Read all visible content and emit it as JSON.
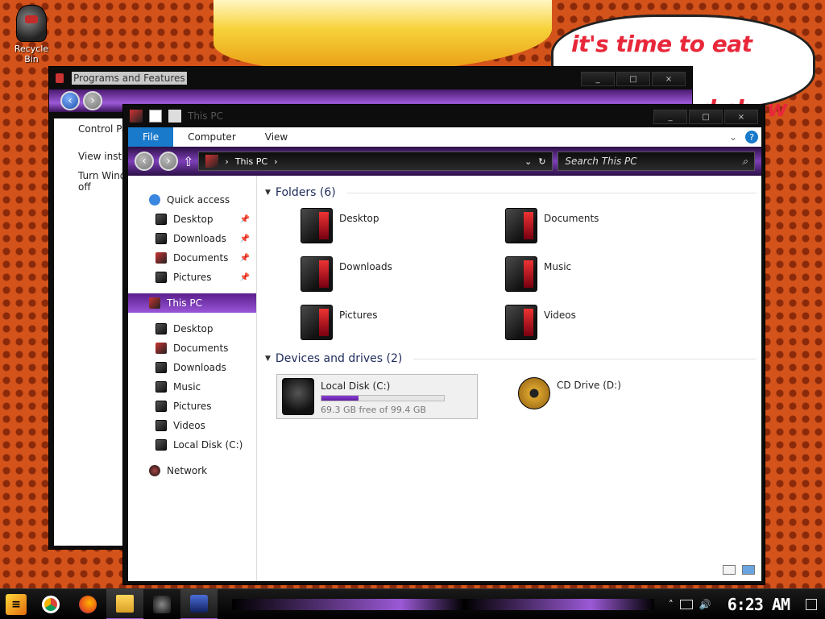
{
  "wallpaper": {
    "speech_line1": "it's time to eat shit",
    "speech_line2": "d chew",
    "speech_line3": "nd"
  },
  "desktop": {
    "icons": [
      {
        "label": "Recycle Bin",
        "icon": "recycle-bin-icon"
      }
    ]
  },
  "back_window": {
    "title": "Programs and Features",
    "controls": [
      "_",
      "□",
      "×"
    ],
    "sidebar": [
      "Control Pa",
      "View insta",
      "Turn Wind",
      "off"
    ]
  },
  "front_window": {
    "title": "This PC",
    "controls": [
      "_",
      "□",
      "×"
    ],
    "ribbon": {
      "tabs": [
        "File",
        "Computer",
        "View"
      ],
      "help": "?"
    },
    "address": {
      "path": "This PC",
      "separator": "›"
    },
    "search": {
      "placeholder": "Search This PC"
    },
    "nav": {
      "quick_access": "Quick access",
      "quick_items": [
        "Desktop",
        "Downloads",
        "Documents",
        "Pictures"
      ],
      "this_pc": "This PC",
      "pc_items": [
        "Desktop",
        "Documents",
        "Downloads",
        "Music",
        "Pictures",
        "Videos",
        "Local Disk (C:)"
      ],
      "network": "Network"
    },
    "folders": {
      "header": "Folders (6)",
      "items": [
        "Desktop",
        "Documents",
        "Downloads",
        "Music",
        "Pictures",
        "Videos"
      ]
    },
    "drives": {
      "header": "Devices and drives (2)",
      "items": [
        {
          "name": "Local Disk (C:)",
          "free": "69.3 GB free of 99.4 GB",
          "used_fraction": 0.3
        },
        {
          "name": "CD Drive (D:)"
        }
      ]
    }
  },
  "taskbar": {
    "clock": "6:23 AM",
    "apps": [
      "chrome-icon",
      "firefox-icon",
      "file-explorer-icon",
      "app-icon",
      "programs-and-features-icon"
    ]
  },
  "colors": {
    "accent": "#9b59d6",
    "file_tab": "#1979ca"
  }
}
